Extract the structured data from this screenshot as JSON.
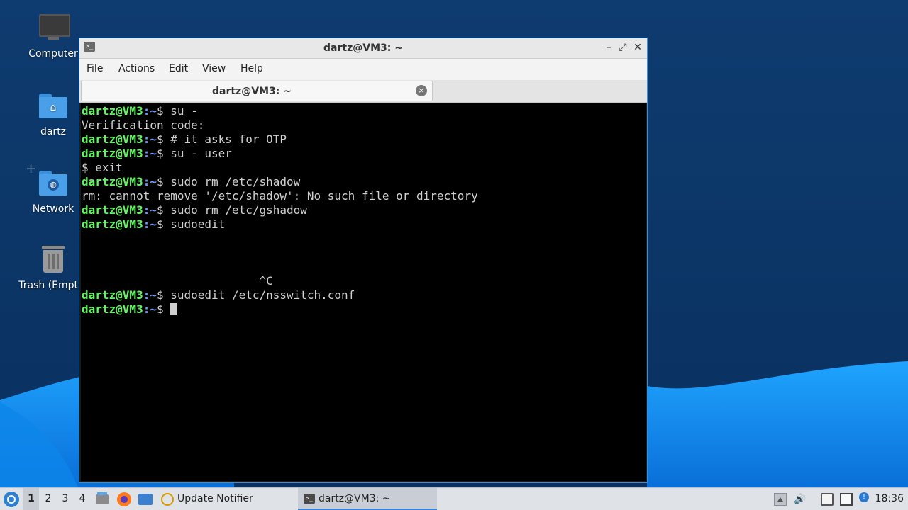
{
  "desktop": {
    "icons": [
      {
        "label": "Computer",
        "icon": "computer-monitor-icon"
      },
      {
        "label": "dartz",
        "icon": "home-folder-icon"
      },
      {
        "label": "Network",
        "icon": "network-folder-icon"
      },
      {
        "label": "Trash (Empty)",
        "icon": "trash-icon"
      }
    ]
  },
  "window": {
    "title": "dartz@VM3: ~",
    "controls": {
      "minimize": "–",
      "maximize": "⤢",
      "close": "✕"
    },
    "menu": [
      "File",
      "Actions",
      "Edit",
      "View",
      "Help"
    ],
    "tab": {
      "label": "dartz@VM3: ~",
      "close": "×"
    }
  },
  "terminal": {
    "prompt_user": "dartz@VM3",
    "prompt_path": ":~",
    "prompt_sign": "$ ",
    "lines": [
      {
        "type": "prompt",
        "cmd": "su -"
      },
      {
        "type": "output",
        "text": "Verification code:"
      },
      {
        "type": "prompt",
        "cmd": "# it asks for OTP"
      },
      {
        "type": "prompt",
        "cmd": "su - user"
      },
      {
        "type": "output",
        "text": "$ exit"
      },
      {
        "type": "prompt",
        "cmd": "sudo rm /etc/shadow"
      },
      {
        "type": "output",
        "text": "rm: cannot remove '/etc/shadow': No such file or directory"
      },
      {
        "type": "prompt",
        "cmd": "sudo rm /etc/gshadow"
      },
      {
        "type": "prompt",
        "cmd": "sudoedit"
      },
      {
        "type": "output",
        "text": ""
      },
      {
        "type": "output",
        "text": ""
      },
      {
        "type": "output",
        "text": ""
      },
      {
        "type": "output",
        "text": "                          ^C"
      },
      {
        "type": "prompt",
        "cmd": "sudoedit /etc/nsswitch.conf"
      },
      {
        "type": "prompt",
        "cmd": "",
        "cursor": true
      }
    ]
  },
  "taskbar": {
    "workspaces": [
      "1",
      "2",
      "3",
      "4"
    ],
    "active_workspace": "1",
    "tasks": [
      {
        "label": "Update Notifier",
        "icon": "update-notifier-icon"
      },
      {
        "label": "dartz@VM3: ~",
        "icon": "terminal-icon"
      }
    ],
    "clock": "18:36"
  },
  "colors": {
    "accent": "#3b8fd8",
    "prompt_user": "#5ff55f",
    "prompt_path": "#6f9bff"
  }
}
